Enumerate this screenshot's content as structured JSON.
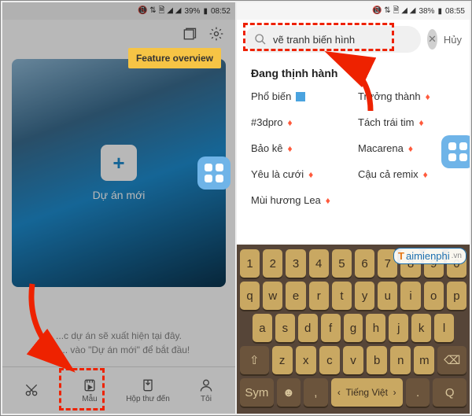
{
  "left": {
    "status": {
      "signal": "◢",
      "wifi": "�his",
      "battery_pct": "39%",
      "time": "08:52",
      "icons": "✕ ⚑ ⌁ ◢ ◢"
    },
    "tooltip": "Feature overview",
    "new_project_label": "Dự án mới",
    "hint_line1": "...c dự án sẽ xuất hiện tại đây.",
    "hint_line2": "Nh... vào \"Dự án mới\" để bắt đầu!",
    "nav": {
      "cut_label": "",
      "template_label": "Mẫu",
      "inbox_label": "Hộp thư đến",
      "me_label": "Tôi"
    }
  },
  "right": {
    "status": {
      "battery_pct": "38%",
      "time": "08:55",
      "icons": "✕ ⚑ ⌁ ◢ ◢"
    },
    "search_value": "vẽ tranh biến hình",
    "cancel": "Hủy",
    "trending_header": "Đang thịnh hành",
    "tags": {
      "t1": "Phổ biến",
      "t2": "Trưởng thành",
      "t3": "#3dpro",
      "t4": "Tách trái tim",
      "t5": "Bảo kê",
      "t6": "Macarena",
      "t7": "Yêu là cưới",
      "t8": "Cậu cả remix",
      "t9": "Mùi hương Lea"
    },
    "kb_space": "Tiếng Việt",
    "kb_sym": "Sym"
  },
  "watermark": "aimienphi",
  "watermark_suffix": ".vn"
}
